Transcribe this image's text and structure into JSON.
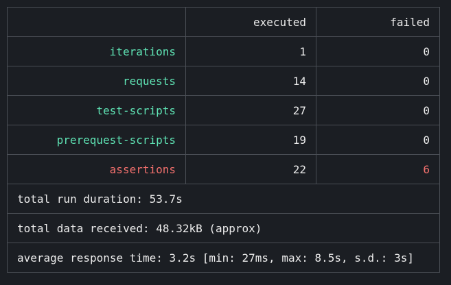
{
  "header": {
    "col_label": "",
    "col_executed": "executed",
    "col_failed": "failed"
  },
  "rows": [
    {
      "name": "iterations",
      "executed": "1",
      "failed": "0"
    },
    {
      "name": "requests",
      "executed": "14",
      "failed": "0"
    },
    {
      "name": "test-scripts",
      "executed": "27",
      "failed": "0"
    },
    {
      "name": "prerequest-scripts",
      "executed": "19",
      "failed": "0"
    },
    {
      "name": "assertions",
      "executed": "22",
      "failed": "6"
    }
  ],
  "stats": {
    "duration": "total run duration: 53.7s",
    "data_received": "total data received: 48.32kB (approx)",
    "response_time": "average response time: 3.2s [min: 27ms, max: 8.5s, s.d.: 3s]"
  },
  "colors": {
    "ok_label": "#5fe3b4",
    "failure": "#ef6f6c",
    "border": "#4a4e55",
    "background": "#1b1e23"
  }
}
